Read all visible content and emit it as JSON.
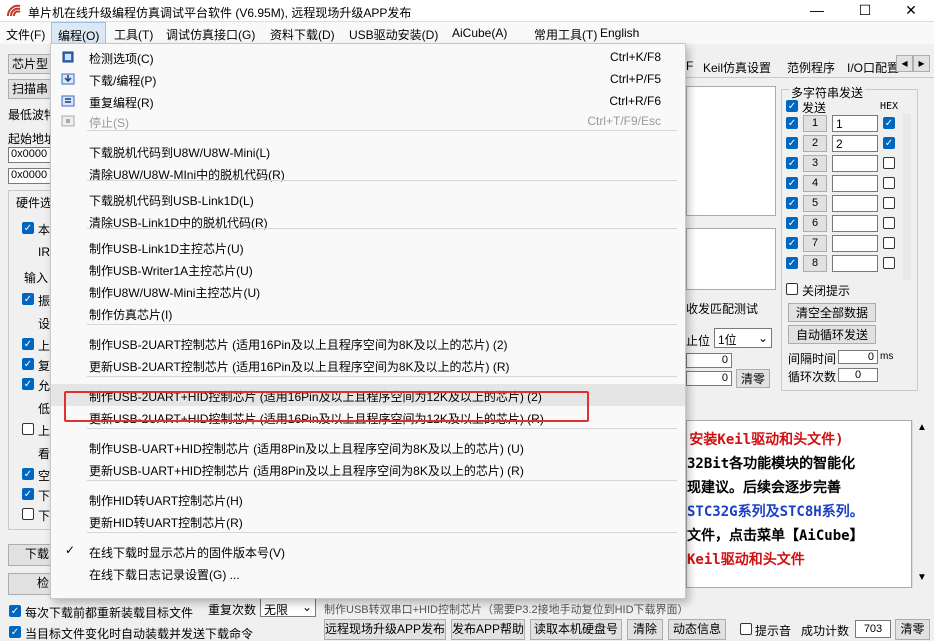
{
  "window": {
    "title": "单片机在线升级编程仿真调试平台软件 (V6.95M), 远程现场升级APP发布",
    "min_glyph": "—",
    "max_glyph": "☐",
    "close_glyph": "✕"
  },
  "menubar": [
    "文件(F)",
    "编程(O)",
    "工具(T)",
    "调试仿真接口(G)",
    "资料下载(D)",
    "USB驱动安装(D)",
    "AiCube(A)",
    "常用工具(T)",
    "English"
  ],
  "dropdown": {
    "items": [
      {
        "label": "检测选项(C)",
        "shortcut": "Ctrl+K/F8",
        "icon": "chip-icon"
      },
      {
        "label": "下载/编程(P)",
        "shortcut": "Ctrl+P/F5",
        "icon": "download-icon"
      },
      {
        "label": "重复编程(R)",
        "shortcut": "Ctrl+R/F6",
        "icon": "repeat-icon"
      },
      {
        "label": "停止(S)",
        "shortcut": "Ctrl+T/F9/Esc",
        "icon": "stop-icon"
      },
      {
        "label": "下载脱机代码到U8W/U8W-Mini(L)"
      },
      {
        "label": "清除U8W/U8W-MIni中的脱机代码(R)"
      },
      {
        "label": "下载脱机代码到USB-Link1D(L)"
      },
      {
        "label": "清除USB-Link1D中的脱机代码(R)"
      },
      {
        "label": "制作USB-Link1D主控芯片(U)"
      },
      {
        "label": "制作USB-Writer1A主控芯片(U)"
      },
      {
        "label": "制作U8W/U8W-Mini主控芯片(U)"
      },
      {
        "label": "制作仿真芯片(I)"
      },
      {
        "label": "制作USB-2UART控制芯片 (适用16Pin及以上且程序空间为8K及以上的芯片) (2)"
      },
      {
        "label": "更新USB-2UART控制芯片 (适用16Pin及以上且程序空间为8K及以上的芯片) (R)"
      },
      {
        "label": "制作USB-2UART+HID控制芯片 (适用16Pin及以上且程序空间为12K及以上的芯片) (2)"
      },
      {
        "label": "更新USB-2UART+HID控制芯片 (适用16Pin及以上且程序空间为12K及以上的芯片) (R)"
      },
      {
        "label": "制作USB-UART+HID控制芯片 (适用8Pin及以上且程序空间为8K及以上的芯片) (U)"
      },
      {
        "label": "更新USB-UART+HID控制芯片 (适用8Pin及以上且程序空间为8K及以上的芯片) (R)"
      },
      {
        "label": "制作HID转UART控制芯片(H)"
      },
      {
        "label": "更新HID转UART控制芯片(R)"
      },
      {
        "label": "在线下载时显示芯片的固件版本号(V)",
        "checked": "✓"
      },
      {
        "label": "在线下载日志记录设置(G) ..."
      }
    ]
  },
  "left": {
    "chip_btn": "芯片型",
    "scan_btn": "扫描串",
    "baud_label": "最低波特",
    "start_addr_label": "起始地址",
    "addr1": "0x0000",
    "addr2": "0x0000",
    "hw_label": "硬件选",
    "frag_ir": "IR",
    "frag_input": "输入",
    "frag_vib": "振",
    "frag_set": "设",
    "frag_up": "上",
    "frag_rst": "复",
    "frag_allow": "允",
    "frag_low": "低",
    "frag_up2": "上",
    "frag_look": "看",
    "frag_empty": "空",
    "frag_dl": "下",
    "frag_dl2": "下",
    "frag_ben": "本",
    "dl_btn": "下载",
    "check_btn": "检"
  },
  "tabs": {
    "f_tab": "F",
    "keil_tab": "Keil仿真设置",
    "sample_tab": "范例程序",
    "io_tab": "I/O口配置",
    "left_arrow": "◂",
    "right_arrow": "▸"
  },
  "serial": {
    "multi_title": "多字符串发送",
    "send_label": "发送",
    "hex_label": "HEX",
    "rows": [
      {
        "n": "1",
        "val": "1"
      },
      {
        "n": "2",
        "val": "2"
      },
      {
        "n": "3",
        "val": ""
      },
      {
        "n": "4",
        "val": ""
      },
      {
        "n": "5",
        "val": ""
      },
      {
        "n": "6",
        "val": ""
      },
      {
        "n": "7",
        "val": ""
      },
      {
        "n": "8",
        "val": ""
      }
    ],
    "close_hint": "关闭提示",
    "clear_all": "清空全部数据",
    "auto_loop": "自动循环发送",
    "interval_label": "间隔时间",
    "interval_val": "0",
    "interval_unit": "ms",
    "loop_label": "循环次数",
    "loop_val": "0",
    "match_test": "收发匹配测试",
    "stopbit_label": "止位",
    "stopbit_val": "1位",
    "count1": "0",
    "count2": "0",
    "clear_btn": "清零"
  },
  "code_lines": [
    "(安装Keil驱动和头文件)",
    "32Bit各功能模块的智能化",
    "各功能模块的智能化",
    "现建议。后续会逐步完善",
    "STC32G系列及STC8H系列。",
    "文件，点击菜单【AiCube】",
    "Keil驱动和头文件"
  ],
  "bottom": {
    "reload_chk": "每次下载前都重新装载目标文件",
    "repeat_label": "重复次数",
    "repeat_val": "无限",
    "auto_chk": "当目标文件变化时自动装载并发送下载命令",
    "status_text": "制作USB转双串口+HID控制芯片（需要P3.2接地手动复位到HID下载界面）",
    "btn_remote": "远程现场升级APP发布",
    "btn_help": "发布APP帮助",
    "btn_disk": "读取本机硬盘号",
    "btn_clear": "清除",
    "btn_dyn": "动态信息",
    "chk_sound": "提示音",
    "success_label": "成功计数",
    "success_val": "703",
    "btn_clear2": "清零"
  },
  "colors": {
    "red_box": "#e03030",
    "accent": "#0067c0",
    "code_red": "#d01010",
    "code_blue": "#1a3ec8"
  }
}
